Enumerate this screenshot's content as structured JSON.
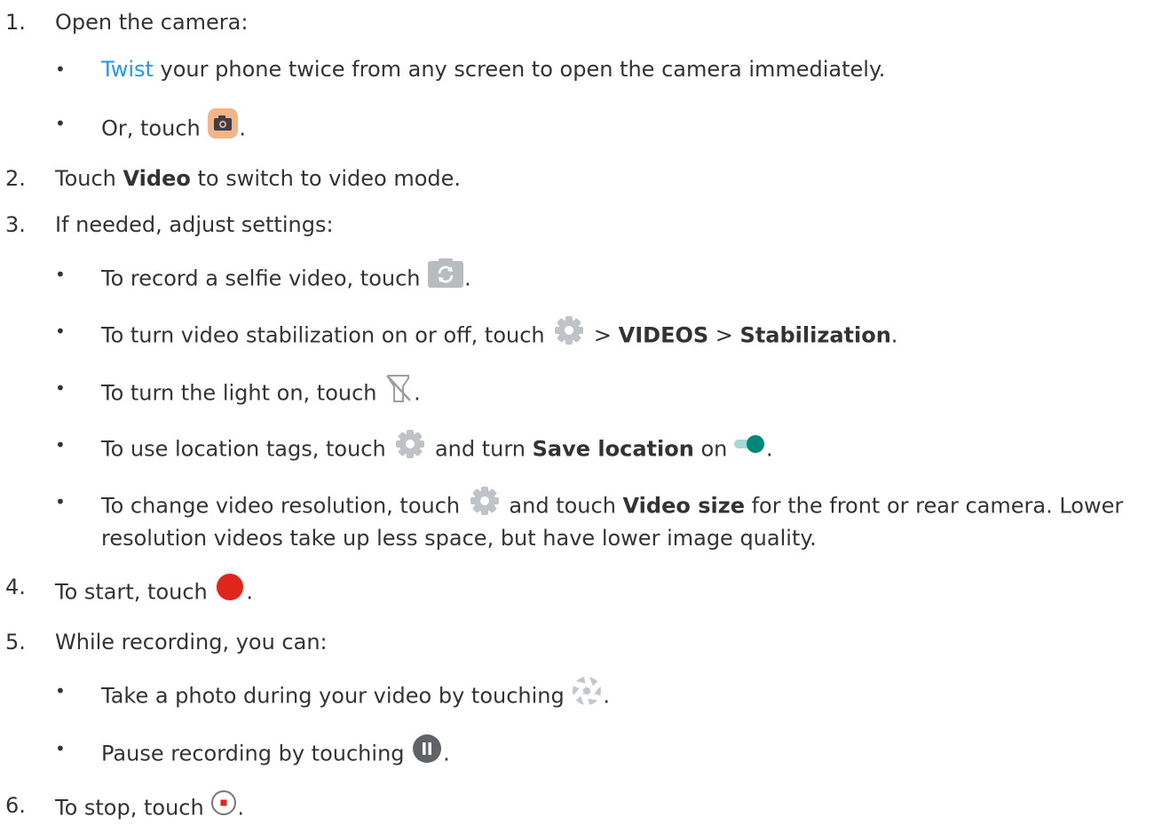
{
  "steps": [
    {
      "number": "1.",
      "text": "Open the camera:",
      "bullets": [
        {
          "link": "Twist",
          "text": " your phone twice from any screen to open the camera immediately."
        },
        {
          "text": "Or, touch ",
          "icon": "camera-app-icon",
          "after": "."
        }
      ]
    },
    {
      "number": "2.",
      "pre": "Touch ",
      "bold": "Video",
      "post": " to switch to video mode."
    },
    {
      "number": "3.",
      "text": "If needed, adjust settings:",
      "bullets": [
        {
          "text": "To record a selfie video, touch ",
          "icon": "switch-camera-icon",
          "after": "."
        },
        {
          "text": "To turn video stabilization on or off, touch ",
          "icon": "settings-gear-icon",
          "sep1": " > ",
          "bold1": "VIDEOS",
          "sep2": " > ",
          "bold2": "Stabilization",
          "after": "."
        },
        {
          "text": "To turn the light on, touch ",
          "icon": "flashlight-off-icon",
          "after": "."
        },
        {
          "text": "To use location tags, touch ",
          "icon": "settings-gear-icon",
          "mid": " and turn ",
          "bold": "Save location",
          "mid2": " on ",
          "icon2": "toggle-on-icon",
          "after": "."
        },
        {
          "text": "To change video resolution, touch ",
          "icon": "settings-gear-icon",
          "mid": " and touch ",
          "bold": "Video size",
          "post": " for the front or rear camera. Lower",
          "line2": "resolution videos take up less space, but have lower image quality."
        }
      ]
    },
    {
      "number": "4.",
      "text": "To start, touch ",
      "icon": "record-button-icon",
      "after": "."
    },
    {
      "number": "5.",
      "text": "While recording, you can:",
      "bullets": [
        {
          "text": "Take a photo during your video by touching ",
          "icon": "shutter-icon",
          "after": "."
        },
        {
          "text": "Pause recording by touching ",
          "icon": "pause-icon",
          "after": "."
        }
      ]
    },
    {
      "number": "6.",
      "text": "To stop, touch ",
      "icon": "stop-button-icon",
      "after": "."
    }
  ],
  "bullet_char": "•",
  "colors": {
    "text": "#333333",
    "link": "#2196f3",
    "record": "#e0261a",
    "toggle": "#00897b",
    "icon_gray": "#9e9e9e",
    "camera_bg": "#f4b48a"
  }
}
